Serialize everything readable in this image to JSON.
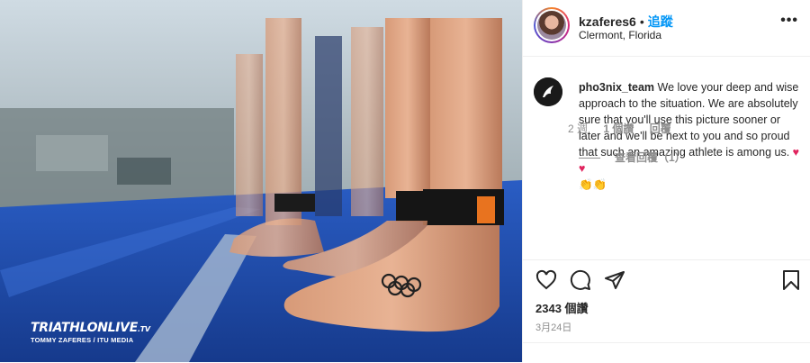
{
  "post": {
    "username": "kzaferes6",
    "separator": "•",
    "follow_label": "追蹤",
    "location": "Clermont, Florida",
    "more_icon": "more-horizontal-icon",
    "more_label": "•••"
  },
  "photo": {
    "watermark_title": "TRIATHLON",
    "watermark_live": "LIVE",
    "watermark_tv": ".TV",
    "watermark_credit": "TOMMY ZAFERES / ITU MEDIA"
  },
  "comment": {
    "username": "pho3nix_team",
    "text": "We love your deep and wise approach to the situation. We are absolutely sure that you'll use this picture sooner or later and we'll be next to you and so proud that such an amazing athlete is among us.",
    "emoji_hearts": "♥ ♥",
    "emoji_clap": "👏👏",
    "time": "2 週",
    "likes": "1 個讚",
    "reply": "回覆",
    "view_replies": "查看回覆（1）"
  },
  "actions": {
    "like_icon": "heart-icon",
    "comment_icon": "comment-icon",
    "share_icon": "paper-plane-icon",
    "save_icon": "bookmark-icon"
  },
  "stats": {
    "likes": "2343 個讚",
    "date": "3月24日"
  },
  "colors": {
    "accent": "#0095f6",
    "muted": "#8e8e8e",
    "heart": "#e0245e",
    "track_blue": "#1c3c7a"
  }
}
